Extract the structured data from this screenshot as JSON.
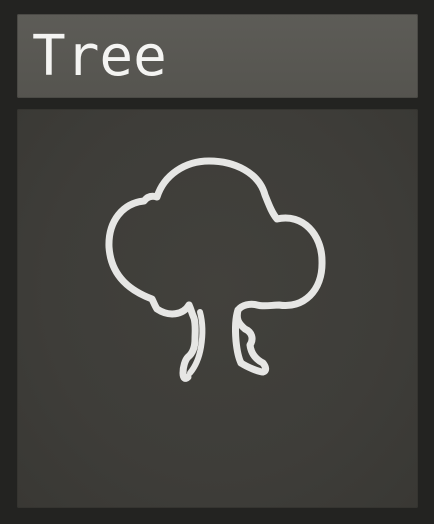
{
  "card": {
    "title": "Tree",
    "icon": "tree-icon"
  },
  "colors": {
    "background": "#232321",
    "title_bar": "#5a5954",
    "art_panel": "#3f3e3a",
    "title_text": "#f4f4f2",
    "icon_stroke": "#e6e6e4"
  }
}
